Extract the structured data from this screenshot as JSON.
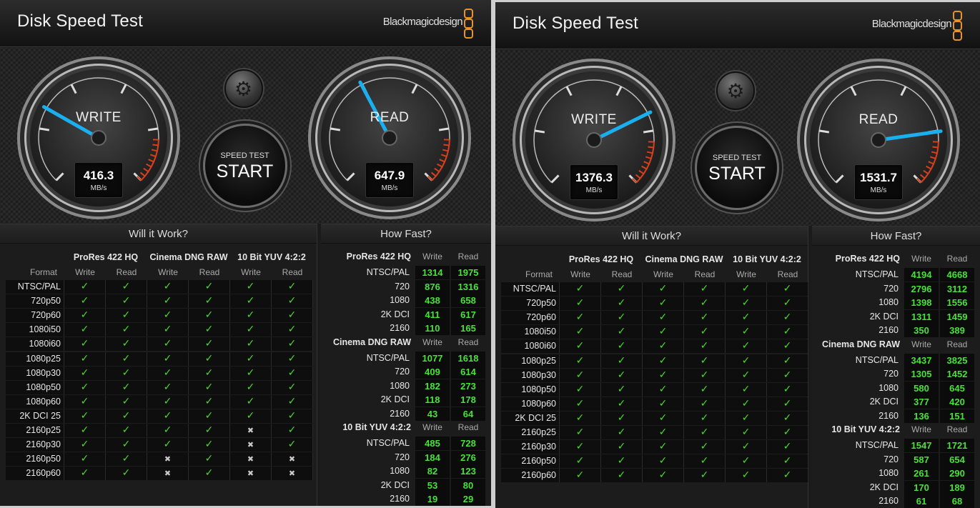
{
  "windows": [
    {
      "title": "Disk Speed Test",
      "brand": "Blackmagicdesign",
      "write": {
        "label": "WRITE",
        "value": "416.3",
        "unit": "MB/s",
        "needle_mbps": 416.3
      },
      "read": {
        "label": "READ",
        "value": "647.9",
        "unit": "MB/s",
        "needle_mbps": 647.9
      },
      "start": {
        "small": "SPEED TEST",
        "big": "START"
      },
      "will_it_work": {
        "title": "Will it Work?",
        "codecs": [
          "ProRes 422 HQ",
          "Cinema DNG RAW",
          "10 Bit YUV 4:2:2"
        ],
        "format_label": "Format",
        "write_label": "Write",
        "read_label": "Read",
        "rows": [
          {
            "format": "NTSC/PAL",
            "v": [
              1,
              1,
              1,
              1,
              1,
              1
            ]
          },
          {
            "format": "720p50",
            "v": [
              1,
              1,
              1,
              1,
              1,
              1
            ]
          },
          {
            "format": "720p60",
            "v": [
              1,
              1,
              1,
              1,
              1,
              1
            ]
          },
          {
            "format": "1080i50",
            "v": [
              1,
              1,
              1,
              1,
              1,
              1
            ]
          },
          {
            "format": "1080i60",
            "v": [
              1,
              1,
              1,
              1,
              1,
              1
            ]
          },
          {
            "format": "1080p25",
            "v": [
              1,
              1,
              1,
              1,
              1,
              1
            ]
          },
          {
            "format": "1080p30",
            "v": [
              1,
              1,
              1,
              1,
              1,
              1
            ]
          },
          {
            "format": "1080p50",
            "v": [
              1,
              1,
              1,
              1,
              1,
              1
            ]
          },
          {
            "format": "1080p60",
            "v": [
              1,
              1,
              1,
              1,
              1,
              1
            ]
          },
          {
            "format": "2K DCI 25",
            "v": [
              1,
              1,
              1,
              1,
              1,
              1
            ]
          },
          {
            "format": "2160p25",
            "v": [
              1,
              1,
              1,
              1,
              0,
              1
            ]
          },
          {
            "format": "2160p30",
            "v": [
              1,
              1,
              1,
              1,
              0,
              1
            ]
          },
          {
            "format": "2160p50",
            "v": [
              1,
              1,
              0,
              1,
              0,
              0
            ]
          },
          {
            "format": "2160p60",
            "v": [
              1,
              1,
              0,
              1,
              0,
              0
            ]
          }
        ]
      },
      "how_fast": {
        "title": "How Fast?",
        "write_label": "Write",
        "read_label": "Read",
        "groups": [
          {
            "name": "ProRes 422 HQ",
            "rows": [
              [
                "NTSC/PAL",
                "1314",
                "1975"
              ],
              [
                "720",
                "876",
                "1316"
              ],
              [
                "1080",
                "438",
                "658"
              ],
              [
                "2K DCI",
                "411",
                "617"
              ],
              [
                "2160",
                "110",
                "165"
              ]
            ]
          },
          {
            "name": "Cinema DNG RAW",
            "rows": [
              [
                "NTSC/PAL",
                "1077",
                "1618"
              ],
              [
                "720",
                "409",
                "614"
              ],
              [
                "1080",
                "182",
                "273"
              ],
              [
                "2K DCI",
                "118",
                "178"
              ],
              [
                "2160",
                "43",
                "64"
              ]
            ]
          },
          {
            "name": "10 Bit YUV 4:2:2",
            "rows": [
              [
                "NTSC/PAL",
                "485",
                "728"
              ],
              [
                "720",
                "184",
                "276"
              ],
              [
                "1080",
                "82",
                "123"
              ],
              [
                "2K DCI",
                "53",
                "80"
              ],
              [
                "2160",
                "19",
                "29"
              ]
            ]
          }
        ]
      }
    },
    {
      "title": "Disk Speed Test",
      "brand": "Blackmagicdesign",
      "write": {
        "label": "WRITE",
        "value": "1376.3",
        "unit": "MB/s",
        "needle_mbps": 1376.3
      },
      "read": {
        "label": "READ",
        "value": "1531.7",
        "unit": "MB/s",
        "needle_mbps": 1531.7
      },
      "start": {
        "small": "SPEED TEST",
        "big": "START"
      },
      "will_it_work": {
        "title": "Will it Work?",
        "codecs": [
          "ProRes 422 HQ",
          "Cinema DNG RAW",
          "10 Bit YUV 4:2:2"
        ],
        "format_label": "Format",
        "write_label": "Write",
        "read_label": "Read",
        "rows": [
          {
            "format": "NTSC/PAL",
            "v": [
              1,
              1,
              1,
              1,
              1,
              1
            ]
          },
          {
            "format": "720p50",
            "v": [
              1,
              1,
              1,
              1,
              1,
              1
            ]
          },
          {
            "format": "720p60",
            "v": [
              1,
              1,
              1,
              1,
              1,
              1
            ]
          },
          {
            "format": "1080i50",
            "v": [
              1,
              1,
              1,
              1,
              1,
              1
            ]
          },
          {
            "format": "1080i60",
            "v": [
              1,
              1,
              1,
              1,
              1,
              1
            ]
          },
          {
            "format": "1080p25",
            "v": [
              1,
              1,
              1,
              1,
              1,
              1
            ]
          },
          {
            "format": "1080p30",
            "v": [
              1,
              1,
              1,
              1,
              1,
              1
            ]
          },
          {
            "format": "1080p50",
            "v": [
              1,
              1,
              1,
              1,
              1,
              1
            ]
          },
          {
            "format": "1080p60",
            "v": [
              1,
              1,
              1,
              1,
              1,
              1
            ]
          },
          {
            "format": "2K DCI 25",
            "v": [
              1,
              1,
              1,
              1,
              1,
              1
            ]
          },
          {
            "format": "2160p25",
            "v": [
              1,
              1,
              1,
              1,
              1,
              1
            ]
          },
          {
            "format": "2160p30",
            "v": [
              1,
              1,
              1,
              1,
              1,
              1
            ]
          },
          {
            "format": "2160p50",
            "v": [
              1,
              1,
              1,
              1,
              1,
              1
            ]
          },
          {
            "format": "2160p60",
            "v": [
              1,
              1,
              1,
              1,
              1,
              1
            ]
          }
        ]
      },
      "how_fast": {
        "title": "How Fast?",
        "write_label": "Write",
        "read_label": "Read",
        "groups": [
          {
            "name": "ProRes 422 HQ",
            "rows": [
              [
                "NTSC/PAL",
                "4194",
                "4668"
              ],
              [
                "720",
                "2796",
                "3112"
              ],
              [
                "1080",
                "1398",
                "1556"
              ],
              [
                "2K DCI",
                "1311",
                "1459"
              ],
              [
                "2160",
                "350",
                "389"
              ]
            ]
          },
          {
            "name": "Cinema DNG RAW",
            "rows": [
              [
                "NTSC/PAL",
                "3437",
                "3825"
              ],
              [
                "720",
                "1305",
                "1452"
              ],
              [
                "1080",
                "580",
                "645"
              ],
              [
                "2K DCI",
                "377",
                "420"
              ],
              [
                "2160",
                "136",
                "151"
              ]
            ]
          },
          {
            "name": "10 Bit YUV 4:2:2",
            "rows": [
              [
                "NTSC/PAL",
                "1547",
                "1721"
              ],
              [
                "720",
                "587",
                "654"
              ],
              [
                "1080",
                "261",
                "290"
              ],
              [
                "2K DCI",
                "170",
                "189"
              ],
              [
                "2160",
                "61",
                "68"
              ]
            ]
          }
        ]
      }
    }
  ],
  "colors": {
    "needle": "#1ab0f0",
    "ok": "#4cd92e",
    "value": "#48e23a",
    "redzone": "#d8401c",
    "logo": "#e8922e"
  },
  "icons": {
    "gear": "gear-icon",
    "check": "checkmark-icon",
    "cross": "cross-icon",
    "close": "close-icon"
  }
}
